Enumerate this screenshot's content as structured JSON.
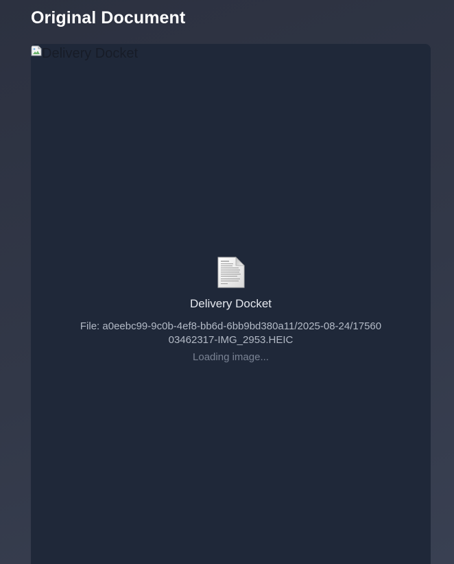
{
  "section": {
    "title": "Original Document"
  },
  "document": {
    "image_alt": "Delivery Docket",
    "title": "Delivery Docket",
    "file_text": "File: a0eebc99-9c0b-4ef8-bb6d-6bb9bd380a11/2025-08-24/1756003462317-IMG_2953.HEIC",
    "loading_text": "Loading image...",
    "icon": "document-page-icon",
    "broken_image_icon": "broken-image-icon"
  },
  "colors": {
    "background": "#323848",
    "panel": "#1f2839",
    "title_text": "#ffffff",
    "muted_text": "#7a8394"
  }
}
